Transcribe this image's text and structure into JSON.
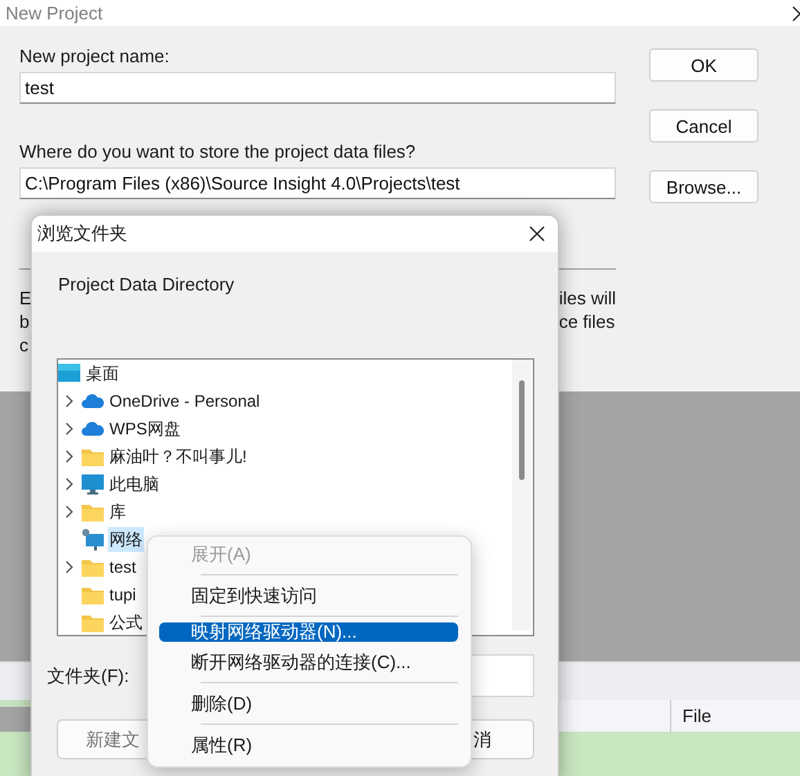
{
  "new_project_dialog": {
    "title": "New Project",
    "name_label": "New project name:",
    "name_value": "test",
    "location_label": "Where do you want to store the project data files?",
    "location_value": "C:\\Program Files (x86)\\Source Insight 4.0\\Projects\\test",
    "buttons": [
      "OK",
      "Cancel",
      "Browse..."
    ],
    "note_left": [
      "E",
      "b",
      "c"
    ],
    "note_right": [
      "iles will",
      "ce files"
    ]
  },
  "background_list": {
    "column_header": "File"
  },
  "browse_dialog": {
    "title": "浏览文件夹",
    "prompt": "Project Data Directory",
    "tree": [
      {
        "label": "桌面",
        "kind": "desktop",
        "selected": false,
        "children": [
          {
            "label": "OneDrive - Personal",
            "kind": "cloud",
            "expandable": true,
            "selected": false
          },
          {
            "label": "WPS网盘",
            "kind": "cloud",
            "expandable": true,
            "selected": false
          },
          {
            "label": "麻油叶？不叫事儿!",
            "kind": "folder",
            "expandable": true,
            "selected": false
          },
          {
            "label": "此电脑",
            "kind": "computer",
            "expandable": true,
            "selected": false
          },
          {
            "label": "库",
            "kind": "folder",
            "expandable": true,
            "selected": false
          },
          {
            "label": "网络",
            "kind": "network",
            "expandable": false,
            "selected": true
          },
          {
            "label": "test",
            "kind": "folder",
            "expandable": true,
            "selected": false
          },
          {
            "label": "tupi",
            "kind": "folder",
            "expandable": false,
            "selected": false
          },
          {
            "label": "公式",
            "kind": "folder",
            "expandable": false,
            "selected": false
          }
        ]
      }
    ],
    "folder_label": "文件夹(F):",
    "buttons": [
      "新建文",
      "消"
    ]
  },
  "context_menu": [
    {
      "kind": "item",
      "label": "展开(A)",
      "disabled": true,
      "selected": false
    },
    {
      "kind": "separator"
    },
    {
      "kind": "item",
      "label": "固定到快速访问",
      "disabled": false,
      "selected": false
    },
    {
      "kind": "separator"
    },
    {
      "kind": "item",
      "label": "映射网络驱动器(N)...",
      "disabled": false,
      "selected": true
    },
    {
      "kind": "item",
      "label": "断开网络驱动器的连接(C)...",
      "disabled": false,
      "selected": false
    },
    {
      "kind": "separator"
    },
    {
      "kind": "item",
      "label": "删除(D)",
      "disabled": false,
      "selected": false
    },
    {
      "kind": "separator"
    },
    {
      "kind": "item",
      "label": "属性(R)",
      "disabled": false,
      "selected": false
    }
  ]
}
